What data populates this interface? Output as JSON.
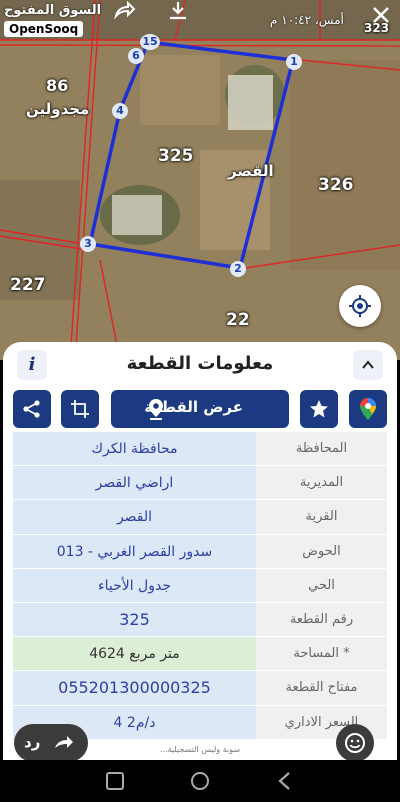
{
  "watermark": {
    "arabic": "السوق المفتوح",
    "english": "OpenSooq"
  },
  "status": {
    "time_text": "أمس، ١٠:٤٢ م"
  },
  "icons": {
    "share_forward": "share-forward-icon",
    "download": "download-icon",
    "close": "close-icon",
    "locate": "crosshair-icon"
  },
  "map": {
    "labels": {
      "parcel_86": "86",
      "majdoulin": "مجدولين",
      "parcel_325": "325",
      "al_qasr": "القصر",
      "parcel_326": "326",
      "parcel_227": "227",
      "parcel_22": "22",
      "parcel_323": "323"
    },
    "vertices": {
      "v15": "15",
      "v6": "6",
      "v1": "1",
      "v4": "4",
      "v3": "3",
      "v2": "2"
    },
    "colors": {
      "boundary": "#1e2fd6",
      "parcel_lines": "#e02424"
    }
  },
  "sheet": {
    "title": "معلومات القطعة",
    "info_label": "i",
    "show_parcel_label": "عرض القطعة"
  },
  "table": {
    "rows": [
      {
        "key": "المحافظة",
        "value": "محافظة الكرك"
      },
      {
        "key": "المديرية",
        "value": "اراضي القصر"
      },
      {
        "key": "القرية",
        "value": "القصر"
      },
      {
        "key": "الحوض",
        "value": "سدور القصر الغربي - 013"
      },
      {
        "key": "الحي",
        "value": "جدول الأحياء"
      },
      {
        "key": "رقم القطعة",
        "value": "325"
      },
      {
        "key": "المساحة *",
        "value": "4624  متر مربع"
      },
      {
        "key": "مفتاح القطعة",
        "value": "055201300000325"
      },
      {
        "key": "السعر الاداري",
        "value": "4 د/م2"
      }
    ]
  },
  "bottom": {
    "reply_label": "رد",
    "footer_note": "...سوبة وليس التسجيلية"
  },
  "accent": "#1c3a82"
}
